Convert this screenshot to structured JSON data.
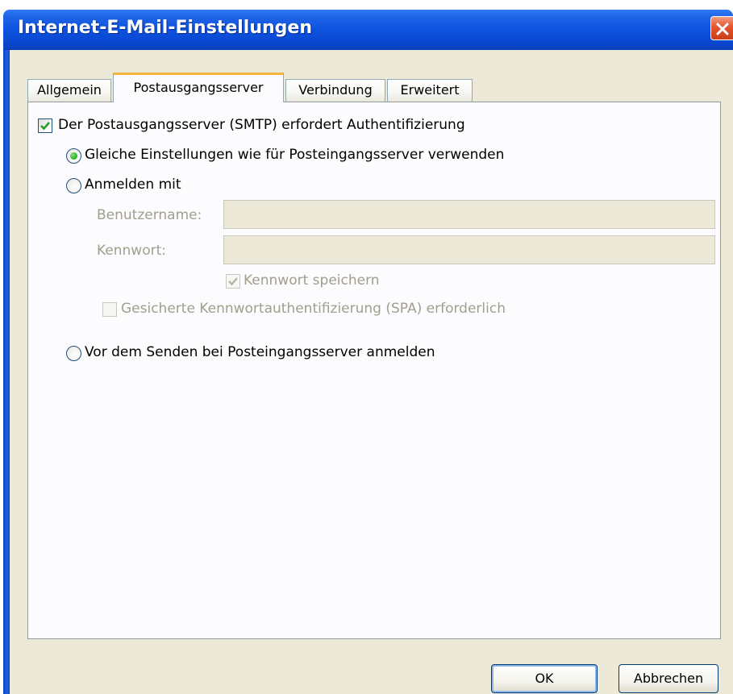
{
  "window": {
    "title": "Internet-E-Mail-Einstellungen"
  },
  "tabs": [
    {
      "label": "Allgemein"
    },
    {
      "label": "Postausgangsserver"
    },
    {
      "label": "Verbindung"
    },
    {
      "label": "Erweitert"
    }
  ],
  "active_tab": "Postausgangsserver",
  "smtp_auth": {
    "label": "Der Postausgangsserver (SMTP) erfordert Authentifizierung",
    "checked": true
  },
  "options": {
    "same_settings": {
      "label": "Gleiche Einstellungen wie für Posteingangsserver verwenden",
      "selected": true
    },
    "login_with": {
      "label": "Anmelden mit",
      "selected": false
    },
    "pop_before_smtp": {
      "label": "Vor dem Senden bei Posteingangsserver anmelden",
      "selected": false
    }
  },
  "login": {
    "username_label": "Benutzername:",
    "username_value": "",
    "password_label": "Kennwort:",
    "password_value": "",
    "save_password": {
      "label": "Kennwort speichern",
      "checked": true,
      "disabled": true
    },
    "spa": {
      "label": "Gesicherte Kennwortauthentifizierung (SPA) erforderlich",
      "checked": false,
      "disabled": true
    }
  },
  "buttons": {
    "ok": "OK",
    "cancel": "Abbrechen"
  },
  "colors": {
    "titlebar": "#0a48d2",
    "dialog_bg": "#ece9d8",
    "active_tab_accent": "#f5b33d",
    "check_green": "#21a121",
    "close_red": "#e2542c"
  },
  "icons": {
    "close": "close-x-icon",
    "check": "checkmark-icon"
  }
}
